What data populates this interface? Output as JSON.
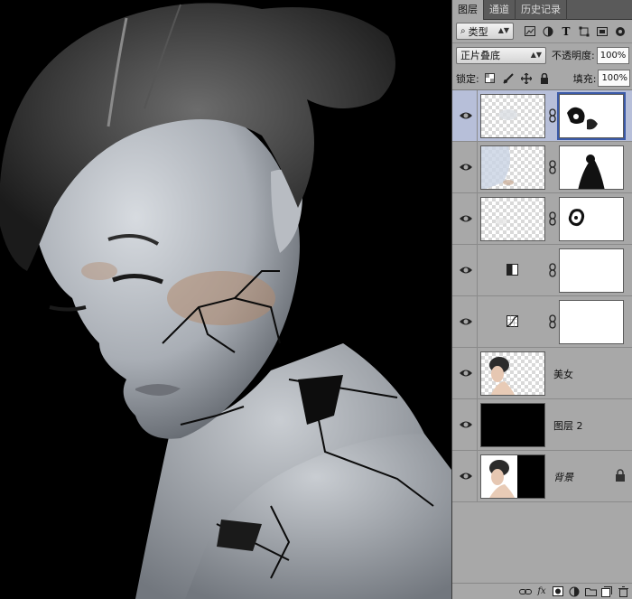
{
  "panel": {
    "tabs": [
      {
        "label": "图层",
        "active": true
      },
      {
        "label": "通道",
        "active": false
      },
      {
        "label": "历史记录",
        "active": false
      }
    ],
    "filter": {
      "label": "类型",
      "icon": "search-icon"
    },
    "blend_mode": "正片叠底",
    "opacity_label": "不透明度:",
    "opacity_value": "100%",
    "lock_label": "锁定:",
    "fill_label": "填充:",
    "fill_value": "100%"
  },
  "layers": [
    {
      "name": "",
      "type": "image-with-mask",
      "visible": true,
      "selected": true
    },
    {
      "name": "",
      "type": "image-with-mask",
      "visible": true,
      "selected": false
    },
    {
      "name": "",
      "type": "image-with-mask",
      "visible": true,
      "selected": false
    },
    {
      "name": "",
      "type": "adjustment-levels-with-mask",
      "visible": true,
      "selected": false
    },
    {
      "name": "",
      "type": "adjustment-curves-with-mask",
      "visible": true,
      "selected": false
    },
    {
      "name": "美女",
      "type": "image",
      "visible": true,
      "selected": false
    },
    {
      "name": "图层 2",
      "type": "fill-black",
      "visible": true,
      "selected": false
    },
    {
      "name": "背景",
      "type": "background",
      "visible": true,
      "selected": false,
      "locked": true
    }
  ],
  "bottom_icons": [
    "link-icon",
    "fx-icon",
    "add-mask-icon",
    "adjustment-icon",
    "folder-icon",
    "new-layer-icon",
    "trash-icon"
  ],
  "colors": {
    "panel_bg": "#a8a8a8",
    "tab_bar": "#5a5a5a",
    "selected_layer": "#b7bfd9",
    "canvas_bg": "#000000"
  }
}
